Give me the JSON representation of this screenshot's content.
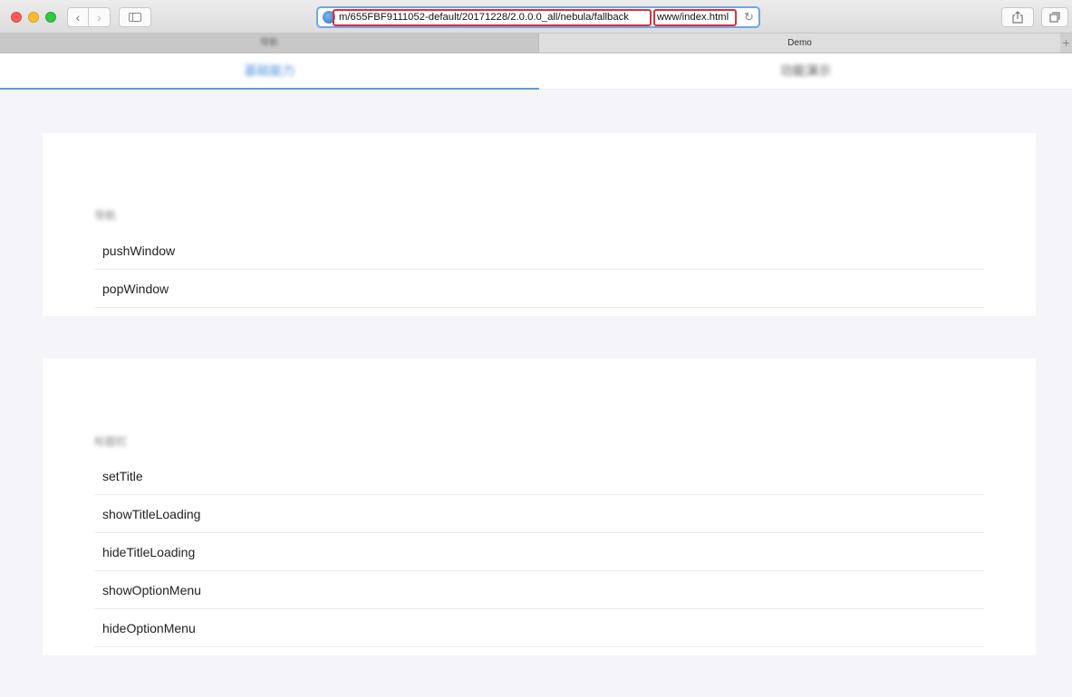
{
  "browser": {
    "url_part1": "m/655FBF9111052-default/20171228/2.0.0.0_all/nebula/fallback",
    "url_part2": "www/index.html",
    "back_icon": "chevron-left-icon",
    "forward_icon": "chevron-right-icon",
    "reload_glyph": "↻",
    "accent_color": "#6fa6e6",
    "highlight_color": "#d3343b"
  },
  "tabs": {
    "first_label": "导航",
    "second_label": "Demo",
    "new_tab_glyph": "+"
  },
  "segments": {
    "first_label": "基础能力",
    "second_label": "功能演示",
    "active_color": "#4a90d9"
  },
  "sections": [
    {
      "label": "导航",
      "items": [
        "pushWindow",
        "popWindow"
      ]
    },
    {
      "label": "标题栏",
      "items": [
        "setTitle",
        "showTitleLoading",
        "hideTitleLoading",
        "showOptionMenu",
        "hideOptionMenu"
      ]
    }
  ]
}
